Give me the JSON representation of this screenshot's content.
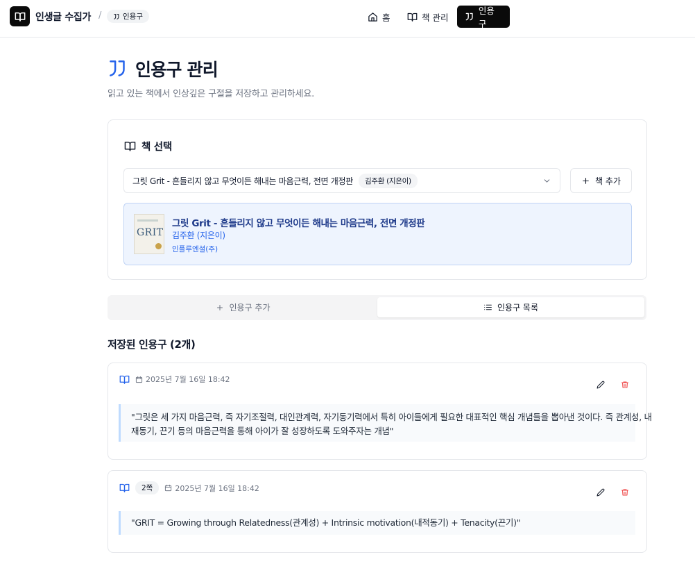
{
  "header": {
    "app_title": "인생글 수집가",
    "breadcrumb_sep": "/",
    "breadcrumb_current": "인용구",
    "nav": [
      {
        "label": "홈",
        "icon": "home-icon"
      },
      {
        "label": "책 관리",
        "icon": "book-icon"
      },
      {
        "label": "인용구",
        "icon": "quote-icon",
        "active": true
      }
    ]
  },
  "page": {
    "title": "인용구 관리",
    "subtitle": "읽고 있는 책에서 인상깊은 구절을 저장하고 관리하세요."
  },
  "book_select": {
    "heading": "책 선택",
    "selected_title": "그릿 Grit - 흔들리지 않고 무엇이든 해내는 마음근력, 전면 개정판",
    "selected_author": "김주환 (지은이)",
    "add_book_label": "책 추가",
    "book": {
      "title": "그릿 Grit - 흔들리지 않고 무엇이든 해내는 마음근력, 전면 개정판",
      "author": "김주환 (지은이)",
      "publisher": "인플루엔셜(주)",
      "cover_text": "GRIT"
    }
  },
  "tabs": [
    {
      "label": "인용구 추가",
      "active": false
    },
    {
      "label": "인용구 목록",
      "active": true
    }
  ],
  "list": {
    "title": "저장된 인용구 (2개)",
    "quotes": [
      {
        "page": "",
        "date": "2025년 7월 16일 18:42",
        "line1": "\"그릿은 세 가지 마음근력, 즉 자기조절력, 대인관계력, 자기동기력에서 특히 아이들에게 필요한 대표적인 핵심 개념들을 뽑아낸 것이다. 즉 관계성, 내",
        "line2": "재동기, 끈기 등의 마음근력을 통해 아이가 잘 성장하도록 도와주자는 개념\""
      },
      {
        "page": "2쪽",
        "date": "2025년 7월 16일 18:42",
        "line1": "\"GRIT = Growing through Relatedness(관계성) + Intrinsic motivation(내적동기) + Tenacity(끈기)\"",
        "line2": ""
      }
    ]
  },
  "colors": {
    "accent_blue": "#2563eb",
    "delete_red": "#ef4444",
    "dark": "#0a0a0a"
  }
}
